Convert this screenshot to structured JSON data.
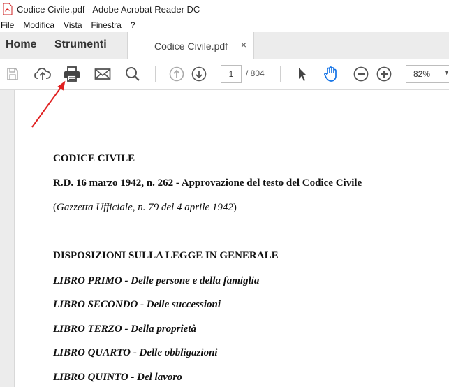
{
  "window": {
    "title": "Codice Civile.pdf - Adobe Acrobat Reader DC"
  },
  "menu": [
    "File",
    "Modifica",
    "Vista",
    "Finestra",
    "?"
  ],
  "tabs": {
    "home": "Home",
    "tools": "Strumenti",
    "document": "Codice Civile.pdf",
    "close": "×"
  },
  "toolbar": {
    "icons": [
      "save-icon",
      "upload-cloud-icon",
      "print-icon",
      "mail-icon",
      "search-icon",
      "prev-page-icon",
      "next-page-icon",
      "select-arrow-icon",
      "hand-tool-icon",
      "zoom-out-icon",
      "zoom-in-icon"
    ],
    "page_current": "1",
    "page_total": "/ 804",
    "zoom": "82%",
    "active_color": "#1473e6"
  },
  "annotation": {
    "arrow_color": "#e02020"
  },
  "document": {
    "title": "CODICE CIVILE",
    "decree": "R.D. 16 marzo 1942, n. 262 - Approvazione del testo del Codice Civile",
    "gazette_open": "(",
    "gazette": "Gazzetta Ufficiale, n. 79 del 4 aprile 1942",
    "gazette_close": ")",
    "general": "DISPOSIZIONI SULLA LEGGE IN GENERALE",
    "books": [
      {
        "name": "LIBRO PRIMO",
        "desc": " - Delle persone e della famiglia"
      },
      {
        "name": "LIBRO SECONDO",
        "desc": " - Delle successioni"
      },
      {
        "name": "LIBRO TERZO",
        "desc": " - Della proprietà"
      },
      {
        "name": "LIBRO QUARTO",
        "desc": " - Delle obbligazioni"
      },
      {
        "name": "LIBRO QUINTO",
        "desc": " - Del lavoro"
      }
    ]
  }
}
